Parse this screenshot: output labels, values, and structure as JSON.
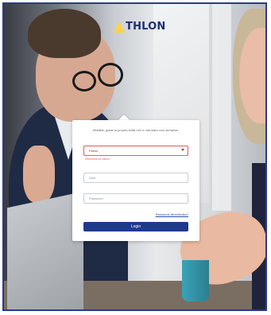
{
  "brand": {
    "name": "THLON"
  },
  "login": {
    "tagline": "Mobilità, guida la propria flotta non è mai stato così semplice.",
    "country_select": {
      "value": "Paese"
    },
    "country_error": "Seleziona un valore",
    "username": {
      "placeholder": "User"
    },
    "password": {
      "placeholder": "Password"
    },
    "forgot_password": "Password dimenticata?",
    "login_button": "Login"
  },
  "colors": {
    "brand_blue": "#1e3a8a",
    "logo_accent": "#ffd24a",
    "error": "#e05a5a",
    "border": "#c9ccd3"
  }
}
